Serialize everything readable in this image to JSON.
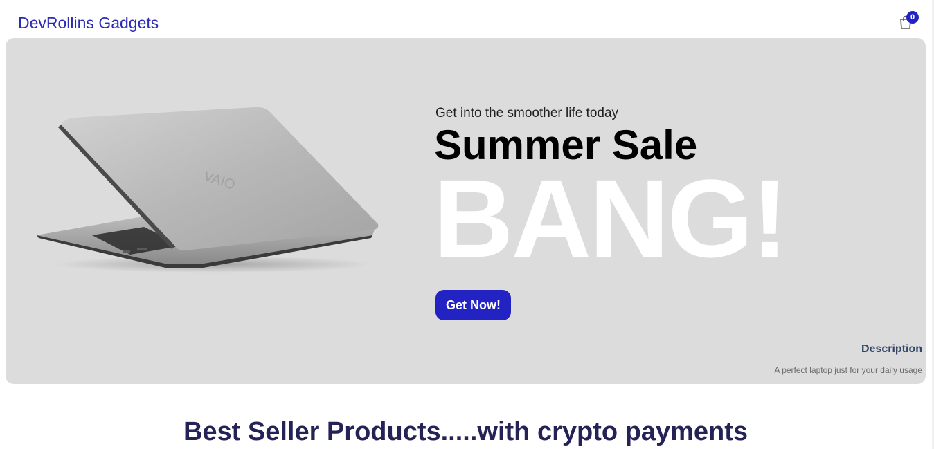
{
  "navbar": {
    "logo_text": "DevRollins Gadgets",
    "cart_icon": "shopping-bag-icon",
    "cart_count": "0"
  },
  "hero": {
    "small_text": "Get into the smoother life today",
    "title": "Summer Sale",
    "big_text": "BANG!",
    "button_label": "Get Now!",
    "description_label": "Description",
    "description_text": "A perfect laptop just for your daily usage",
    "background_color": "#dcdcdc",
    "accent_color": "#2323c4",
    "product_image": "laptop-image"
  },
  "best_sellers": {
    "title": "Best Seller Products.....with crypto payments"
  }
}
